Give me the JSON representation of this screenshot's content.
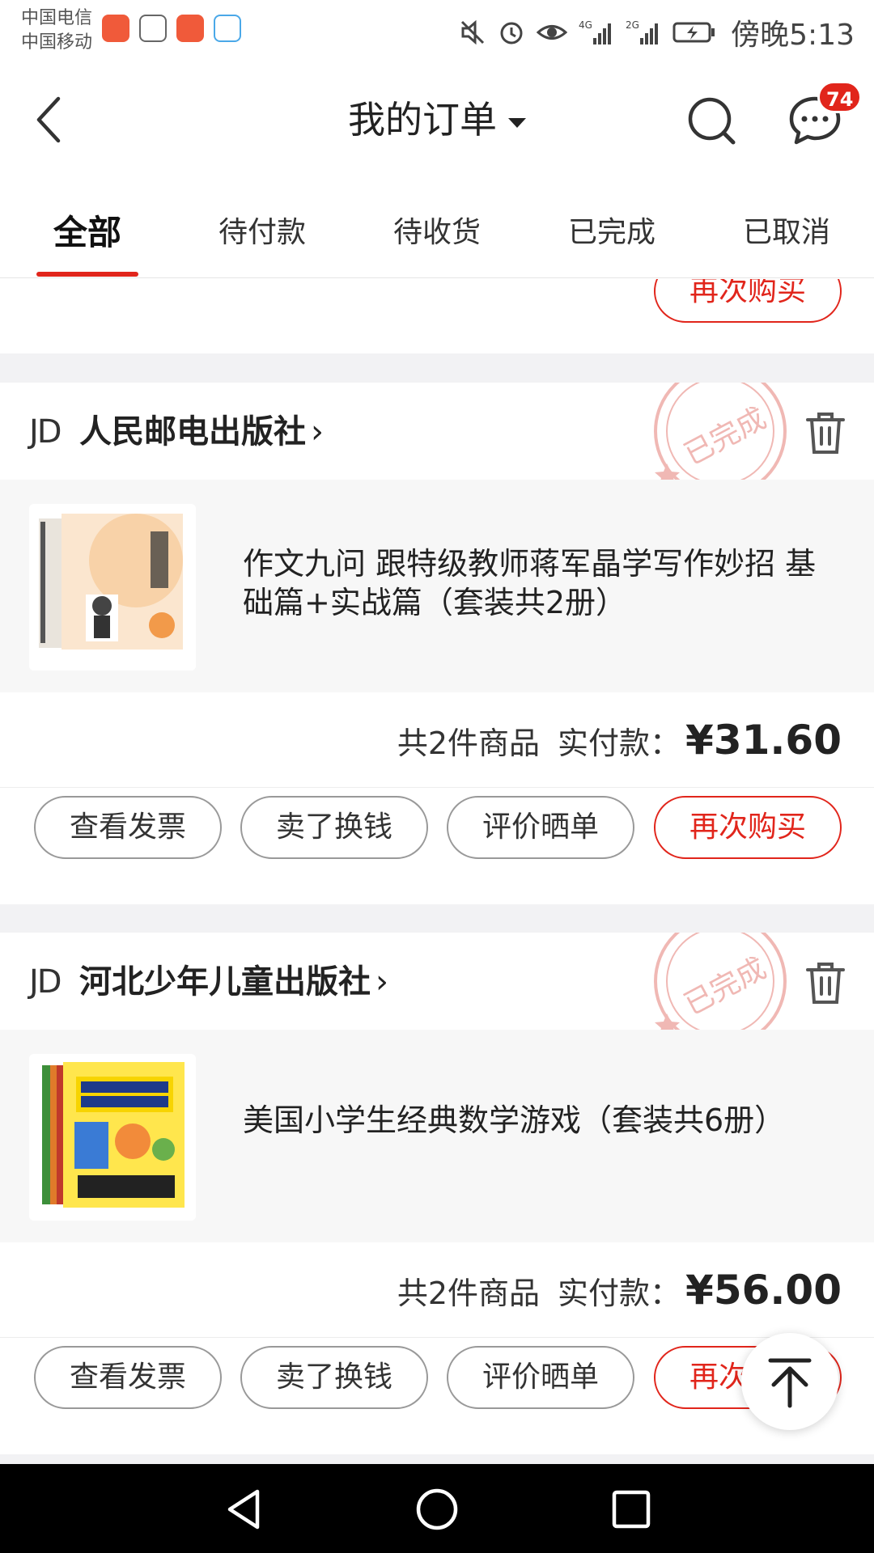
{
  "status_bar": {
    "carrier_1": "中国电信",
    "carrier_2": "中国移动",
    "net_1": "4G",
    "net_2": "2G",
    "time": "傍晚5:13"
  },
  "header": {
    "title": "我的订单",
    "message_badge": "74"
  },
  "tabs": [
    {
      "label": "全部",
      "active": true
    },
    {
      "label": "待付款",
      "active": false
    },
    {
      "label": "待收货",
      "active": false
    },
    {
      "label": "已完成",
      "active": false
    },
    {
      "label": "已取消",
      "active": false
    }
  ],
  "partial_order": {
    "rebuy_label": "再次购买"
  },
  "orders": [
    {
      "brand": "JD",
      "shop": "人民邮电出版社",
      "chevron": "›",
      "stamp": "已完成",
      "goods_title": "作文九问 跟特级教师蒋军晶学写作妙招 基础篇+实战篇（套装共2册）",
      "count_text": "共2件商品",
      "paid_label": "实付款：",
      "price": "¥31.60",
      "actions": [
        "查看发票",
        "卖了换钱",
        "评价晒单",
        "再次购买"
      ]
    },
    {
      "brand": "JD",
      "shop": "河北少年儿童出版社",
      "chevron": "›",
      "stamp": "已完成",
      "goods_title": "美国小学生经典数学游戏（套装共6册）",
      "count_text": "共2件商品",
      "paid_label": "实付款：",
      "price": "¥56.00",
      "actions": [
        "查看发票",
        "卖了换钱",
        "评价晒单",
        "再次购买"
      ]
    }
  ],
  "colors": {
    "accent": "#e1251b",
    "page_bg": "#f2f2f4",
    "goods_bg": "#f7f7f7"
  }
}
